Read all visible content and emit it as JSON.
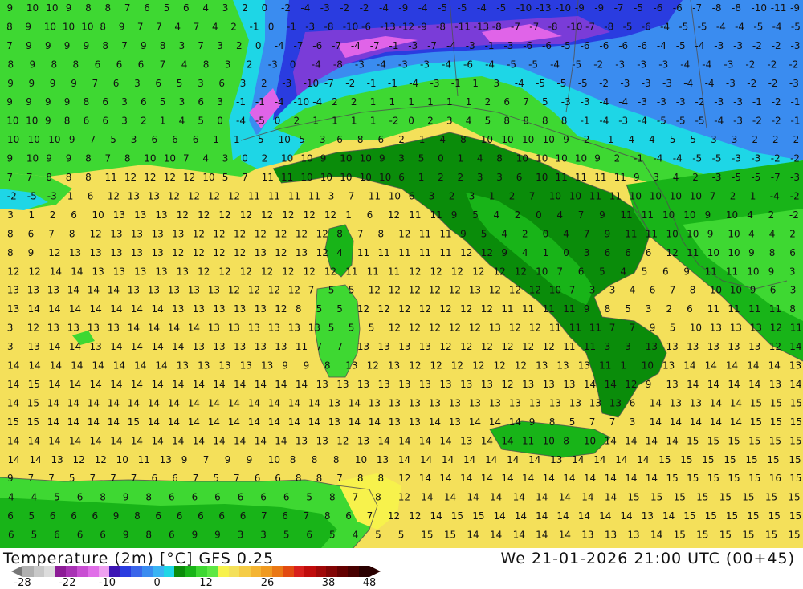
{
  "map": {
    "region": "Italy and Central Mediterranean",
    "colors": {
      "sea_warm": "#f4e05a",
      "sea_mild": "#f7f24c",
      "land_green_light": "#3ed832",
      "land_green": "#18b418",
      "land_green_dark": "#0a8c0a",
      "cold_cyan": "#1ed6e6",
      "cold_blue": "#3a8cf0",
      "cold_deep": "#2a3ce0",
      "cold_purple": "#7a3cd8",
      "cold_magenta": "#e064e8",
      "border": "#505050"
    },
    "label_rows": [
      "9 10 10 9 8 8 7 6 5 6 4 3 2 0 -2 -4 -3 -2 -2 -4 -9 -4 -5 -5 -4 -5 -10 -13 -10 -9 -9 -7 -5 -6 -6 -7 -8 -8 -10 -11 -9",
      "8 9 10 10 10 8 9 7 7 4 7 4 2 -1 0 -1 -3 -8 -10 -6 -13 -12 -9 -8 -11 -13 -8 -7 -7 -8 -10 -7 -8 -5 -6 -4 -5 -5 -4 -4 -5 -4 -5",
      "7 9 9 9 9 8 7 9 8 3 7 3 2 0 -4 -7 -6 -7 -4 -7 -1 -3 -7 -4 -3 -1 -3 -6 -6 -5 -6 -6 -6 -6 -4 -5 -4 -3 -3 -2 -2 -3",
      "8 9 8 8 6 6 6 7 4 8 3 2 -3 0 -4 -8 -3 -4 -3 -3 -4 -6 -4 -5 -5 -4 -5 -2 -3 -3 -3 -4 -4 -3 -2 -2 -2",
      "9 9 9 9 7 6 3 6 5 3 6 3 2 -3 -10 -7 -2 -1 -1 -4 -3 -1 1 3 -4 -5 -5 -5 -2 -3 -3 -3 -4 -4 -3 -2 -2 -3",
      "9 9 9 9 8 6 3 6 5 3 6 3 -1 -1 -4 -10 -4 2 2 1 1 1 1 1 1 2 6 7 5 -3 -3 -4 -4 -3 -3 -3 -2 -3 -3 -1 -2 -1",
      "10 10 9 8 6 6 3 2 1 4 5 0 -4 -5 0 2 1 1 1 1 -2 0 2 3 4 5 8 8 8 8 -1 -4 -3 -4 -5 -5 -5 -4 -3 -2 -2 -1",
      "10 10 10 9 7 5 3 6 6 6 1 1 -5 -10 -5 -3 6 8 6 2 1 4 8 10 10 10 10 9 2 -1 -4 -4 -5 -5 -3 -3 -2 -2 -2",
      "9 10 9 9 8 7 8 10 10 7 4 3 0 2 10 10 9 10 10 9 3 5 0 1 4 8 10 10 10 10 9 2 -1 -4 -4 -5 -5 -3 -3 -2 -2",
      "7 7 8 8 8 11 12 12 12 12 10 5 7 11 11 10 10 10 10 10 6 1 2 2 3 3 6 10 11 11 11 11 9 3 4 2 -3 -5 -5 -7 -3",
      "-2 -5 -3 1 6 12 13 13 12 12 12 12 11 11 11 11 3 7 11 10 6 3 2 3 1 2 7 10 10 11 11 10 10 10 10 7 2 1 -4 -2",
      "3 1 2 6 10 13 13 13 12 12 12 12 12 12 12 12 1 6 12 11 11 9 5 4 2 0 4 7 9 11 11 10 10 9 10 4 2 -2",
      "8 6 7 8 12 13 13 13 13 12 12 12 12 12 12 12 8 7 8 12 11 11 9 5 4 2 0 4 7 9 11 11 10 10 9 10 4 4 2",
      "8 9 12 13 13 13 13 13 12 12 12 12 13 12 13 12 4 11 11 11 11 11 12 12 9 4 1 0 3 6 6 6 12 11 10 10 9 8 6",
      "12 12 14 14 13 13 13 13 13 12 12 12 12 12 12 12 11 11 11 12 12 12 12 12 12 10 7 6 5 4 5 6 9 11 11 10 9 3",
      "13 13 13 14 14 14 13 13 13 13 13 12 12 12 12 7 5 5 12 12 12 12 12 13 12 12 12 10 7 3 3 4 6 7 8 10 10 9 6 3",
      "13 14 14 14 14 14 14 14 13 13 13 13 13 12 8 5 5 12 12 12 12 12 12 12 11 11 11 11 9 8 5 3 2 6 11 11 11 11 8",
      "3 12 13 13 13 13 14 14 14 14 13 13 13 13 13 13 5 5 5 12 12 12 12 12 13 12 12 11 11 11 7 7 9 5 10 13 13 13 12 11",
      "3 13 14 14 13 14 14 14 14 13 13 13 13 13 11 7 7 13 13 13 13 12 12 12 12 12 12 11 11 3 3 13 13 13 13 13 13 12 14",
      "14 14 14 14 14 14 14 14 13 13 13 13 13 9 9 8 13 12 13 12 12 12 12 12 12 13 13 13 11 1 10 13 14 14 14 14 14 13",
      "14 15 14 14 14 14 14 14 14 14 14 14 14 14 14 13 13 13 13 13 13 13 13 13 12 13 13 13 14 14 12 9 13 14 14 14 14 13 14",
      "14 15 14 14 14 14 14 14 14 14 14 14 14 14 14 14 13 14 13 13 13 13 13 13 13 13 13 13 13 13 13 6 14 13 13 14 14 15 15 15",
      "15 15 14 14 14 14 15 14 14 14 14 14 14 14 14 14 13 14 14 13 13 14 13 14 14 14 9 8 5 7 7 3 14 14 14 14 14 15 15 15",
      "14 14 14 14 14 14 14 14 14 14 14 14 14 14 13 13 12 13 14 14 14 14 13 14 14 11 10 8 10 14 14 14 14 15 15 15 15 15 15",
      "14 14 13 12 12 10 11 13 9 7 9 9 10 8 8 8 10 13 14 14 14 14 14 14 14 13 14 14 14 14 15 15 15 15 15 15 15",
      "9 7 7 5 7 7 7 6 6 7 5 7 6 6 8 8 7 8 8 12 14 14 14 14 14 14 14 14 14 14 14 14 15 15 15 15 15 16 15",
      "4 4 5 6 8 9 8 6 6 6 6 6 6 5 8 7 8 12 14 14 14 14 14 14 14 14 14 15 15 15 15 15 15 15 15",
      "6 5 6 6 6 9 8 6 6 6 6 6 7 6 7 8 6 7 12 12 14 15 15 14 14 14 14 14 14 14 13 14 15 15 15 15 15 15",
      "6 5 6 6 6 9 8 6 9 9 3 3 5 6 5 4 5 5 15 15 14 14 14 14 14 13 13 13 14 15 15 15 15 15 15"
    ]
  },
  "footer": {
    "title": "Temperature (2m) [°C] GFS 0.25",
    "valid": "We 21-01-2026 21:00 UTC (00+45)",
    "legend_colors": [
      "#b0b0b0",
      "#c8c8c8",
      "#dcdcdc",
      "#8c1c96",
      "#a832b4",
      "#c84ed2",
      "#e06ee8",
      "#eea0f0",
      "#3c14b4",
      "#2a3ce0",
      "#3a66ea",
      "#3a8cf0",
      "#3ab4f4",
      "#1ed6e6",
      "#0a8c0a",
      "#18b418",
      "#3ed832",
      "#5ee844",
      "#f7f24c",
      "#f4e05a",
      "#f5cc46",
      "#f4b432",
      "#f09a20",
      "#ea7814",
      "#e24a10",
      "#d8201c",
      "#c00c0c",
      "#a00808",
      "#820404",
      "#640000",
      "#480000",
      "#2a0000"
    ],
    "ticks": [
      {
        "label": "-28",
        "pos": 0
      },
      {
        "label": "-22",
        "pos": 0.129
      },
      {
        "label": "-10",
        "pos": 0.244
      },
      {
        "label": "0",
        "pos": 0.388
      },
      {
        "label": "12",
        "pos": 0.529
      },
      {
        "label": "26",
        "pos": 0.706
      },
      {
        "label": "38",
        "pos": 0.882
      },
      {
        "label": "48",
        "pos": 1.0
      }
    ]
  }
}
